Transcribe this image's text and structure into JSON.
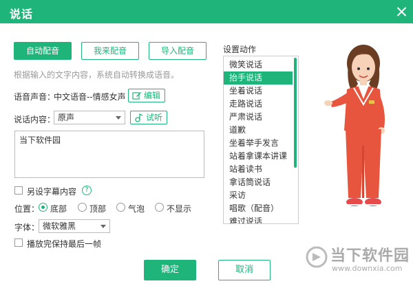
{
  "window": {
    "title": "说话"
  },
  "tabs": [
    {
      "label": "自动配音",
      "active": true
    },
    {
      "label": "我来配音",
      "active": false
    },
    {
      "label": "导入配音",
      "active": false
    }
  ],
  "hint": "根据输入的文字内容，系统自动转换成语音。",
  "voice": {
    "label": "语音声音：",
    "value": "中文语音--情感女声",
    "edit_label": "编辑"
  },
  "content": {
    "label": "说话内容：",
    "selected": "原声",
    "listen_label": "试听"
  },
  "text_value": "当下软件园",
  "subtitle": {
    "label": "另设字幕内容",
    "checked": false,
    "help": "?"
  },
  "position": {
    "label": "位置：",
    "options": [
      {
        "label": "底部",
        "selected": true
      },
      {
        "label": "顶部",
        "selected": false
      },
      {
        "label": "气泡",
        "selected": false
      },
      {
        "label": "不显示",
        "selected": false
      }
    ]
  },
  "font": {
    "label": "字体：",
    "selected": "微软雅黑"
  },
  "keep_last_frame": {
    "label": "播放完保持最后一帧",
    "checked": false
  },
  "actions": {
    "title": "设置动作",
    "items": [
      "微笑说话",
      "抬手说话",
      "坐着说话",
      "走路说话",
      "严肃说话",
      "道歉",
      "坐着举手发言",
      "站着拿课本讲课",
      "站着读书",
      "拿话筒说话",
      "采访",
      "唱歌（配音）",
      "难过说话"
    ],
    "selected_index": 1
  },
  "buttons": {
    "ok": "确定",
    "cancel": "取消"
  },
  "watermark": {
    "text": "当下软件园",
    "url": "www.downxia.com"
  },
  "colors": {
    "accent": "#1fb57a"
  }
}
